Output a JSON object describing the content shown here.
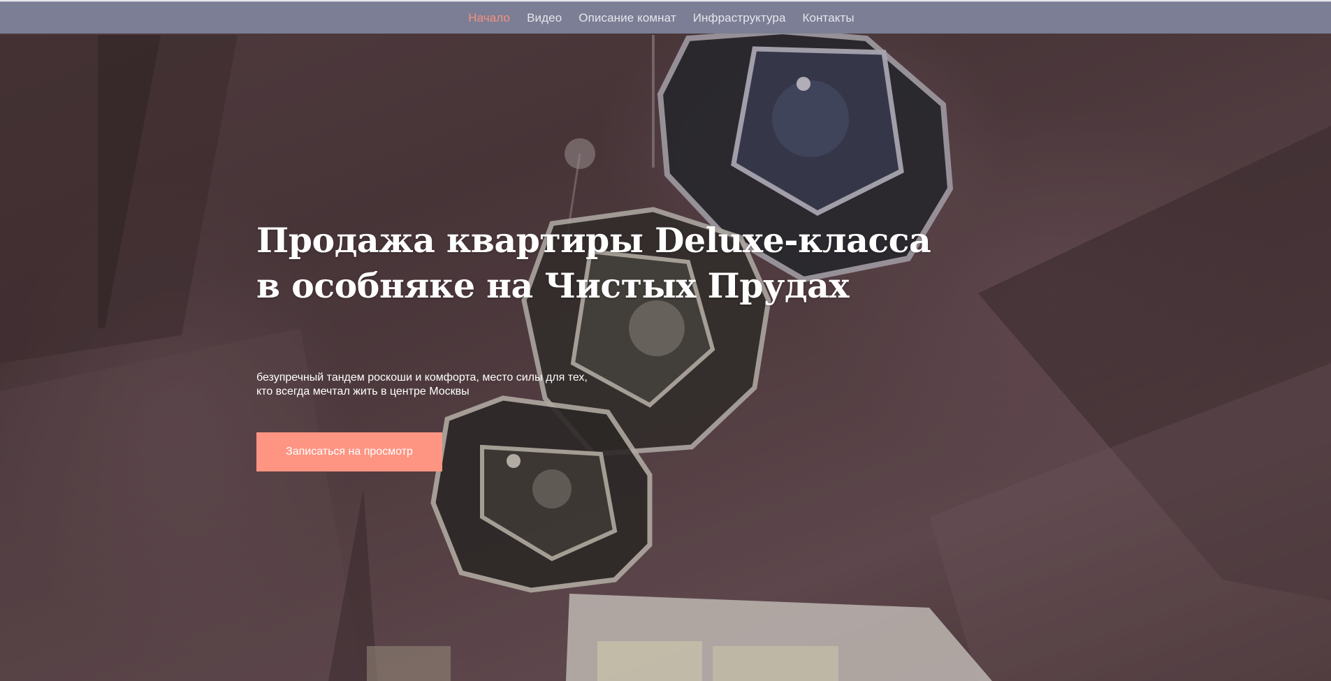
{
  "nav": {
    "items": [
      {
        "label": "Начало",
        "active": true
      },
      {
        "label": "Видео",
        "active": false
      },
      {
        "label": "Описание комнат",
        "active": false
      },
      {
        "label": "Инфраструктура",
        "active": false
      },
      {
        "label": "Контакты",
        "active": false
      }
    ],
    "active_color": "#f7917f",
    "bar_color": "#7b7e94"
  },
  "hero": {
    "title_line_1": "Продажа квартиры Deluxe-класса",
    "title_line_2": "в особняке на Чистых Прудах",
    "subtitle_line_1": "безупречный тандем роскоши и комфорта, место силы для тех,",
    "subtitle_line_2": "кто всегда мечтал жить в центре Москвы",
    "cta_label": "Записаться на просмотр",
    "cta_color": "#fe9583"
  }
}
